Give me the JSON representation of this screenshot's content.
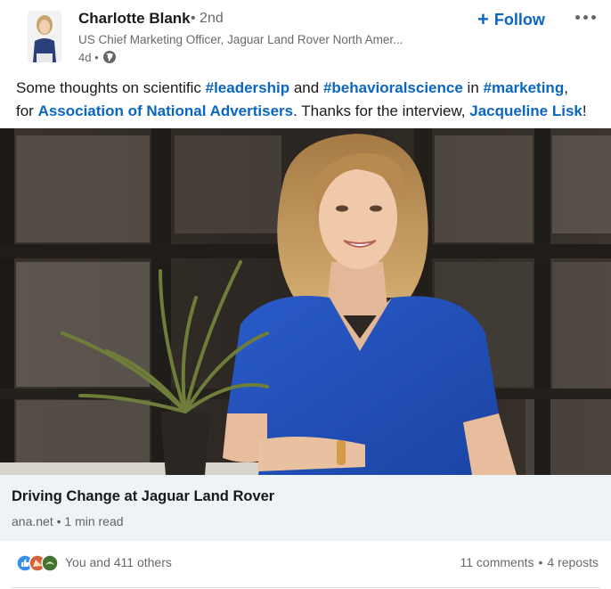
{
  "post": {
    "author": {
      "name": "Charlotte Blank",
      "degree": "• 2nd",
      "headline": "US Chief Marketing Officer, Jaguar Land Rover North Amer...",
      "time": "4d •",
      "visibility_icon": "globe-icon"
    },
    "follow_label": "Follow",
    "commentary": {
      "t1": "Some thoughts on scientific ",
      "tag1": "#leadership",
      "t2": " and ",
      "tag2": "#behavioralscience",
      "t3": " in ",
      "tag3": "#marketing",
      "t4": ",",
      "t5": "for ",
      "mention1": "Association of National Advertisers",
      "t6": ". Thanks for the interview, ",
      "mention2": "Jacqueline Lisk",
      "t7": "!"
    },
    "article": {
      "title": "Driving Change at Jaguar Land Rover",
      "source": "ana.net",
      "read_time": " • 1 min read"
    },
    "social": {
      "reaction_icons": [
        "like-icon",
        "celebrate-icon",
        "support-icon"
      ],
      "reactions_text": "You and 411 others",
      "comments": "11 comments",
      "separator": "•",
      "reposts": "4 reposts"
    }
  },
  "colors": {
    "link": "#0a66c2",
    "card_bg": "#eef3f8",
    "shirt": "#1f4fb5"
  }
}
